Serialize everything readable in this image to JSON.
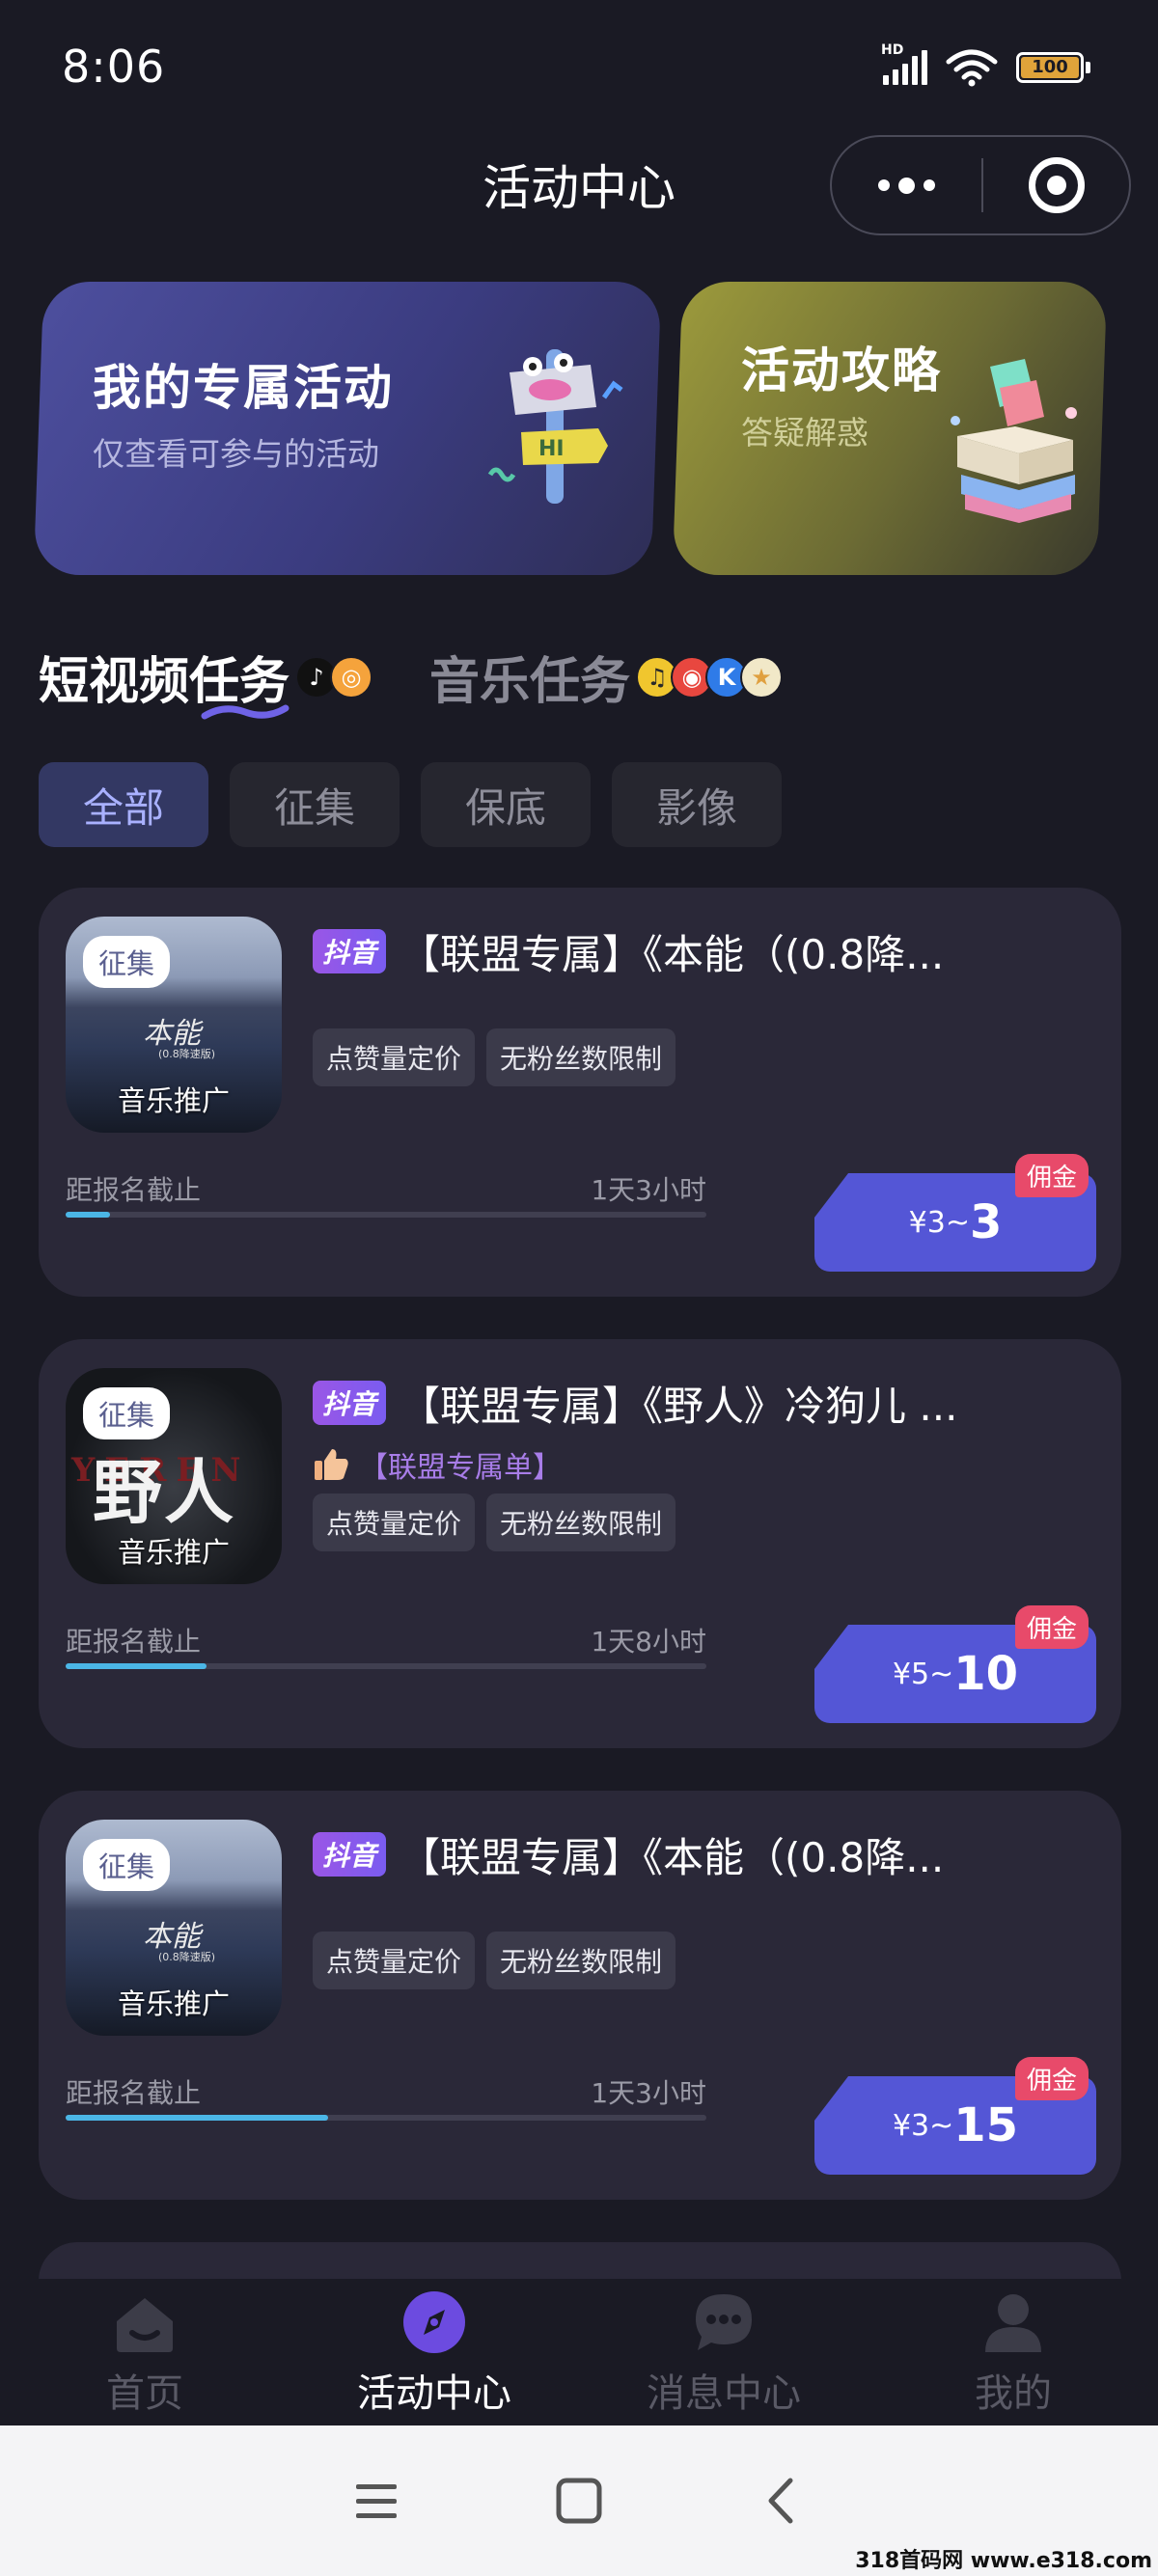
{
  "status_bar": {
    "time": "8:06",
    "battery": "100",
    "network": "HD"
  },
  "header": {
    "title": "活动中心",
    "more_icon": "more-dots-icon",
    "close_icon": "target-circle-icon"
  },
  "banners": {
    "left": {
      "title": "我的专属活动",
      "subtitle": "仅查看可参与的活动"
    },
    "right": {
      "title": "活动攻略",
      "subtitle": "答疑解惑"
    }
  },
  "task_tabs": [
    {
      "label": "短视频任务",
      "active": true
    },
    {
      "label": "音乐任务",
      "active": false
    }
  ],
  "filters": [
    "全部",
    "征集",
    "保底",
    "影像"
  ],
  "tasks": [
    {
      "badge": "征集",
      "cover_caption": "音乐推广",
      "cover_title": "本能",
      "cover_subtitle": "(0.8降速版)",
      "platform": "抖音",
      "title": "【联盟专属】《本能（(0.8降...",
      "subtag": "",
      "tags": [
        "点赞量定价",
        "无粉丝数限制"
      ],
      "deadline_label": "距报名截止",
      "deadline_remain": "1天3小时",
      "progress": 0.07,
      "price_min": "¥3~",
      "price_max": "3",
      "commission_label": "佣金"
    },
    {
      "badge": "征集",
      "cover_caption": "音乐推广",
      "cover_title": "野人",
      "cover_subtitle": "YEREN",
      "platform": "抖音",
      "title": "【联盟专属】《野人》冷狗儿 ...",
      "subtag": "【联盟专属单】",
      "tags": [
        "点赞量定价",
        "无粉丝数限制"
      ],
      "deadline_label": "距报名截止",
      "deadline_remain": "1天8小时",
      "progress": 0.22,
      "price_min": "¥5~",
      "price_max": "10",
      "commission_label": "佣金"
    },
    {
      "badge": "征集",
      "cover_caption": "音乐推广",
      "cover_title": "本能",
      "cover_subtitle": "(0.8降速版)",
      "platform": "抖音",
      "title": "【联盟专属】《本能（(0.8降...",
      "subtag": "",
      "tags": [
        "点赞量定价",
        "无粉丝数限制"
      ],
      "deadline_label": "距报名截止",
      "deadline_remain": "1天3小时",
      "progress": 0.41,
      "price_min": "¥3~",
      "price_max": "15",
      "commission_label": "佣金"
    }
  ],
  "bottom_nav": [
    {
      "label": "首页",
      "icon": "home-icon",
      "active": false
    },
    {
      "label": "活动中心",
      "icon": "compass-icon",
      "active": true
    },
    {
      "label": "消息中心",
      "icon": "chat-bubble-icon",
      "active": false
    },
    {
      "label": "我的",
      "icon": "user-icon",
      "active": false
    }
  ],
  "system_nav": {
    "menu_icon": "menu-icon",
    "home_icon": "square-home-icon",
    "back_icon": "back-chevron-icon"
  },
  "watermark": "318首码网 www.e318.com",
  "colors": {
    "accent": "#5456d6",
    "progress": "#4bb6e6",
    "commission": "#e84a6a",
    "background": "#1a1a24"
  }
}
